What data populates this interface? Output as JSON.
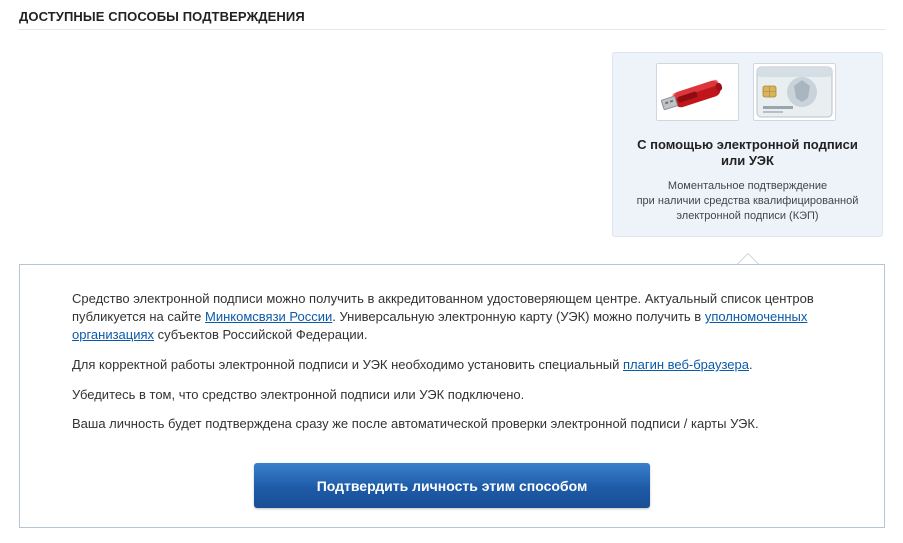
{
  "section": {
    "title": "ДОСТУПНЫЕ СПОСОБЫ ПОДТВЕРЖДЕНИЯ"
  },
  "method_card": {
    "title_line1": "С помощью электронной подписи",
    "title_line2": "или УЭК",
    "desc_line1": "Моментальное подтверждение",
    "desc_line2": "при наличии средства квалифицированной",
    "desc_line3": "электронной подписи (КЭП)",
    "icons": [
      "usb-token-icon",
      "uek-card-icon"
    ]
  },
  "details": {
    "p1_a": "Средство электронной подписи можно получить в аккредитованном удостоверяющем центре. Актуальный список центров публикуется на сайте ",
    "p1_link1": "Минкомсвязи России",
    "p1_b": ". Универсальную электронную карту (УЭК) можно получить в ",
    "p1_link2": "уполномоченных организациях",
    "p1_c": " субъектов Российской Федерации.",
    "p2_a": "Для корректной работы электронной подписи и УЭК необходимо установить специальный ",
    "p2_link": "плагин веб-браузера",
    "p2_b": ".",
    "p3": "Убедитесь в том, что средство электронной подписи или УЭК подключено.",
    "p4": "Ваша личность будет подтверждена сразу же после автоматической проверки электронной подписи / карты УЭК.",
    "confirm_label": "Подтвердить личность этим способом"
  },
  "colors": {
    "link": "#0b5aa8",
    "card_bg": "#eef3fa",
    "button": "#1e5ba7",
    "panel_border": "#b7c6d4"
  }
}
